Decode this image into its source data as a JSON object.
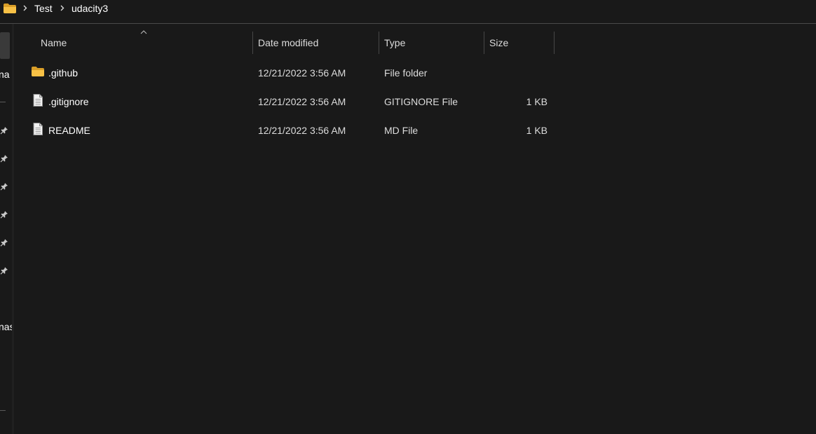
{
  "address_bar": {
    "breadcrumbs": [
      "Test",
      "udacity3"
    ],
    "folder_icon": "folder-icon",
    "separator_icon": "chevron-right-icon"
  },
  "nav_pane": {
    "partial_labels": [
      "na",
      "nas"
    ],
    "pinned_icon": "pin-icon"
  },
  "columns": {
    "name": "Name",
    "date_modified": "Date modified",
    "type": "Type",
    "size": "Size",
    "sorted_by": "Name",
    "sort_direction": "ascending"
  },
  "files": [
    {
      "name": ".github",
      "date": "12/21/2022 3:56 AM",
      "type": "File folder",
      "size": "",
      "icon": "folder-icon"
    },
    {
      "name": ".gitignore",
      "date": "12/21/2022 3:56 AM",
      "type": "GITIGNORE File",
      "size": "1 KB",
      "icon": "document-icon"
    },
    {
      "name": "README",
      "date": "12/21/2022 3:56 AM",
      "type": "MD File",
      "size": "1 KB",
      "icon": "document-icon"
    }
  ],
  "colors": {
    "background": "#191919",
    "text": "#ffffff",
    "header_text": "#dcdcdc",
    "divider": "#474747",
    "folder_yellow": "#f8c146"
  }
}
